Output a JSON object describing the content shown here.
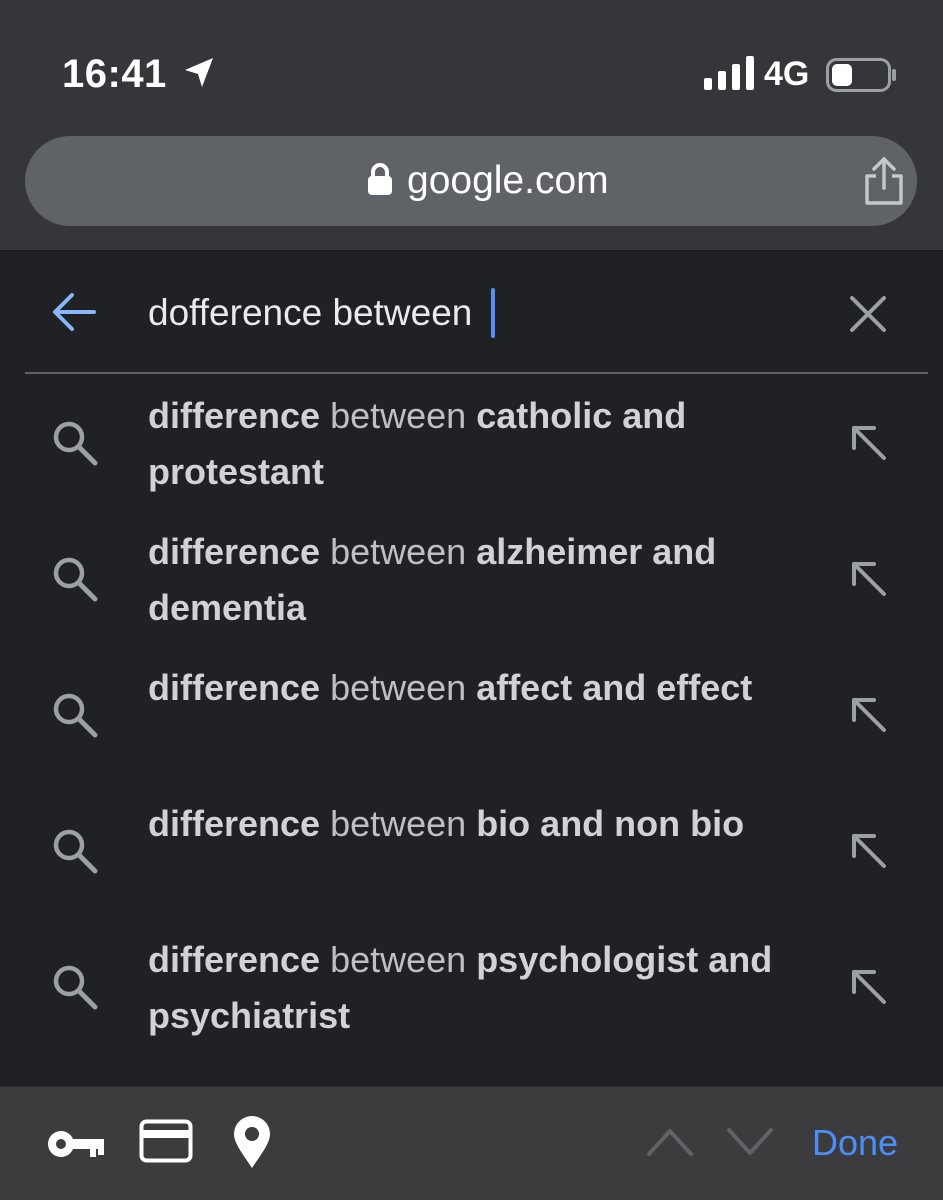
{
  "status_bar": {
    "time": "16:41",
    "network": "4G",
    "icons": [
      "location-arrow-icon",
      "signal-bars-icon",
      "battery-icon"
    ]
  },
  "url_bar": {
    "domain": "google.com",
    "icons": [
      "lock-icon",
      "share-icon"
    ]
  },
  "search": {
    "query": "dofference between ",
    "icons": [
      "back-arrow-icon",
      "clear-icon"
    ]
  },
  "suggestions": [
    {
      "bold_prefix": "difference",
      "middle": " between ",
      "completion": "catholic and protestant"
    },
    {
      "bold_prefix": "difference",
      "middle": " between ",
      "completion": "alzheimer and dementia"
    },
    {
      "bold_prefix": "difference",
      "middle": " between ",
      "completion": "affect and effect"
    },
    {
      "bold_prefix": "difference",
      "middle": " between ",
      "completion": "bio and non bio"
    },
    {
      "bold_prefix": "difference",
      "middle": " between ",
      "completion": "psychologist and psychiatrist"
    }
  ],
  "accessory_bar": {
    "done_label": "Done",
    "icons": [
      "key-icon",
      "credit-card-icon",
      "location-pin-icon",
      "chevron-up-icon",
      "chevron-down-icon"
    ]
  },
  "colors": {
    "accent": "#4c8ef7",
    "background": "#202124",
    "chrome": "#35363a",
    "url_pill": "#5f6368"
  }
}
